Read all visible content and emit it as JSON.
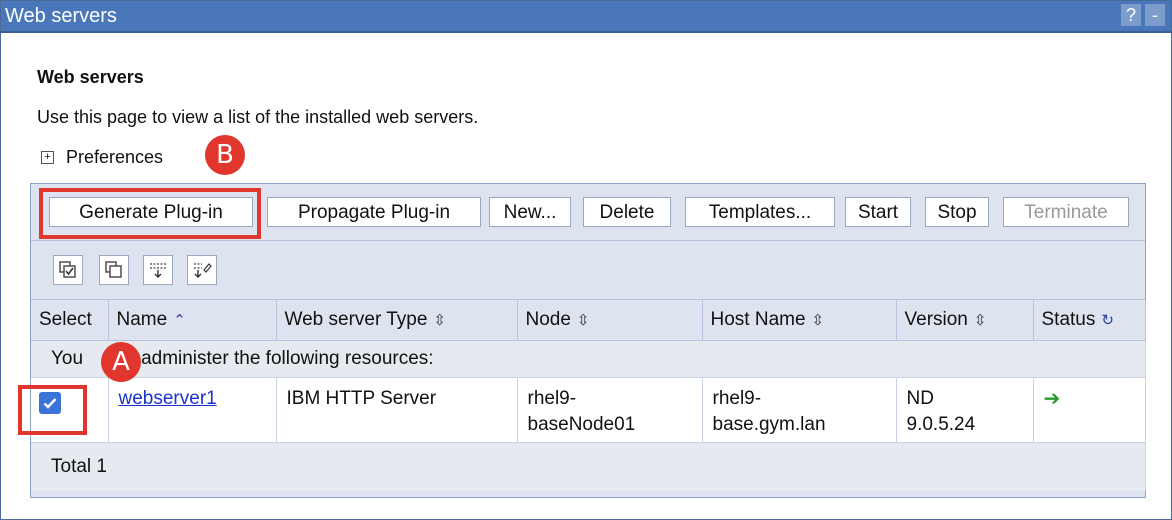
{
  "window": {
    "title": "Web servers",
    "help_label": "?",
    "minimize_label": "-"
  },
  "page": {
    "heading": "Web servers",
    "description": "Use this page to view a list of the installed web servers.",
    "preferences_label": "Preferences",
    "preferences_toggle": "+"
  },
  "toolbar": {
    "generate_plugin": "Generate Plug-in",
    "propagate_plugin": "Propagate Plug-in",
    "new": "New...",
    "delete": "Delete",
    "templates": "Templates...",
    "start": "Start",
    "stop": "Stop",
    "terminate": "Terminate"
  },
  "icon_toolbar": [
    "select-all-icon",
    "deselect-all-icon",
    "show-filter-icon",
    "clear-filter-icon"
  ],
  "table": {
    "headers": {
      "select": "Select",
      "name": "Name",
      "type": "Web server Type",
      "node": "Node",
      "host": "Host Name",
      "version": "Version",
      "status": "Status"
    },
    "notice_prefix": "You",
    "notice_suffix": "administer the following resources:",
    "rows": [
      {
        "selected": true,
        "name": "webserver1",
        "type": "IBM HTTP Server",
        "node_line1": "rhel9-",
        "node_line2": "baseNode01",
        "host_line1": "rhel9-",
        "host_line2": "base.gym.lan",
        "version_line1": "ND",
        "version_line2": "9.0.5.24",
        "status": "started-arrow-icon"
      }
    ],
    "total": "Total 1"
  },
  "annotations": {
    "a_label": "A",
    "b_label": "B"
  },
  "colors": {
    "titlebar": "#4a77b9",
    "callout_red": "#e0362d",
    "link_blue": "#1a33cc",
    "status_green": "#2a9a2a"
  }
}
